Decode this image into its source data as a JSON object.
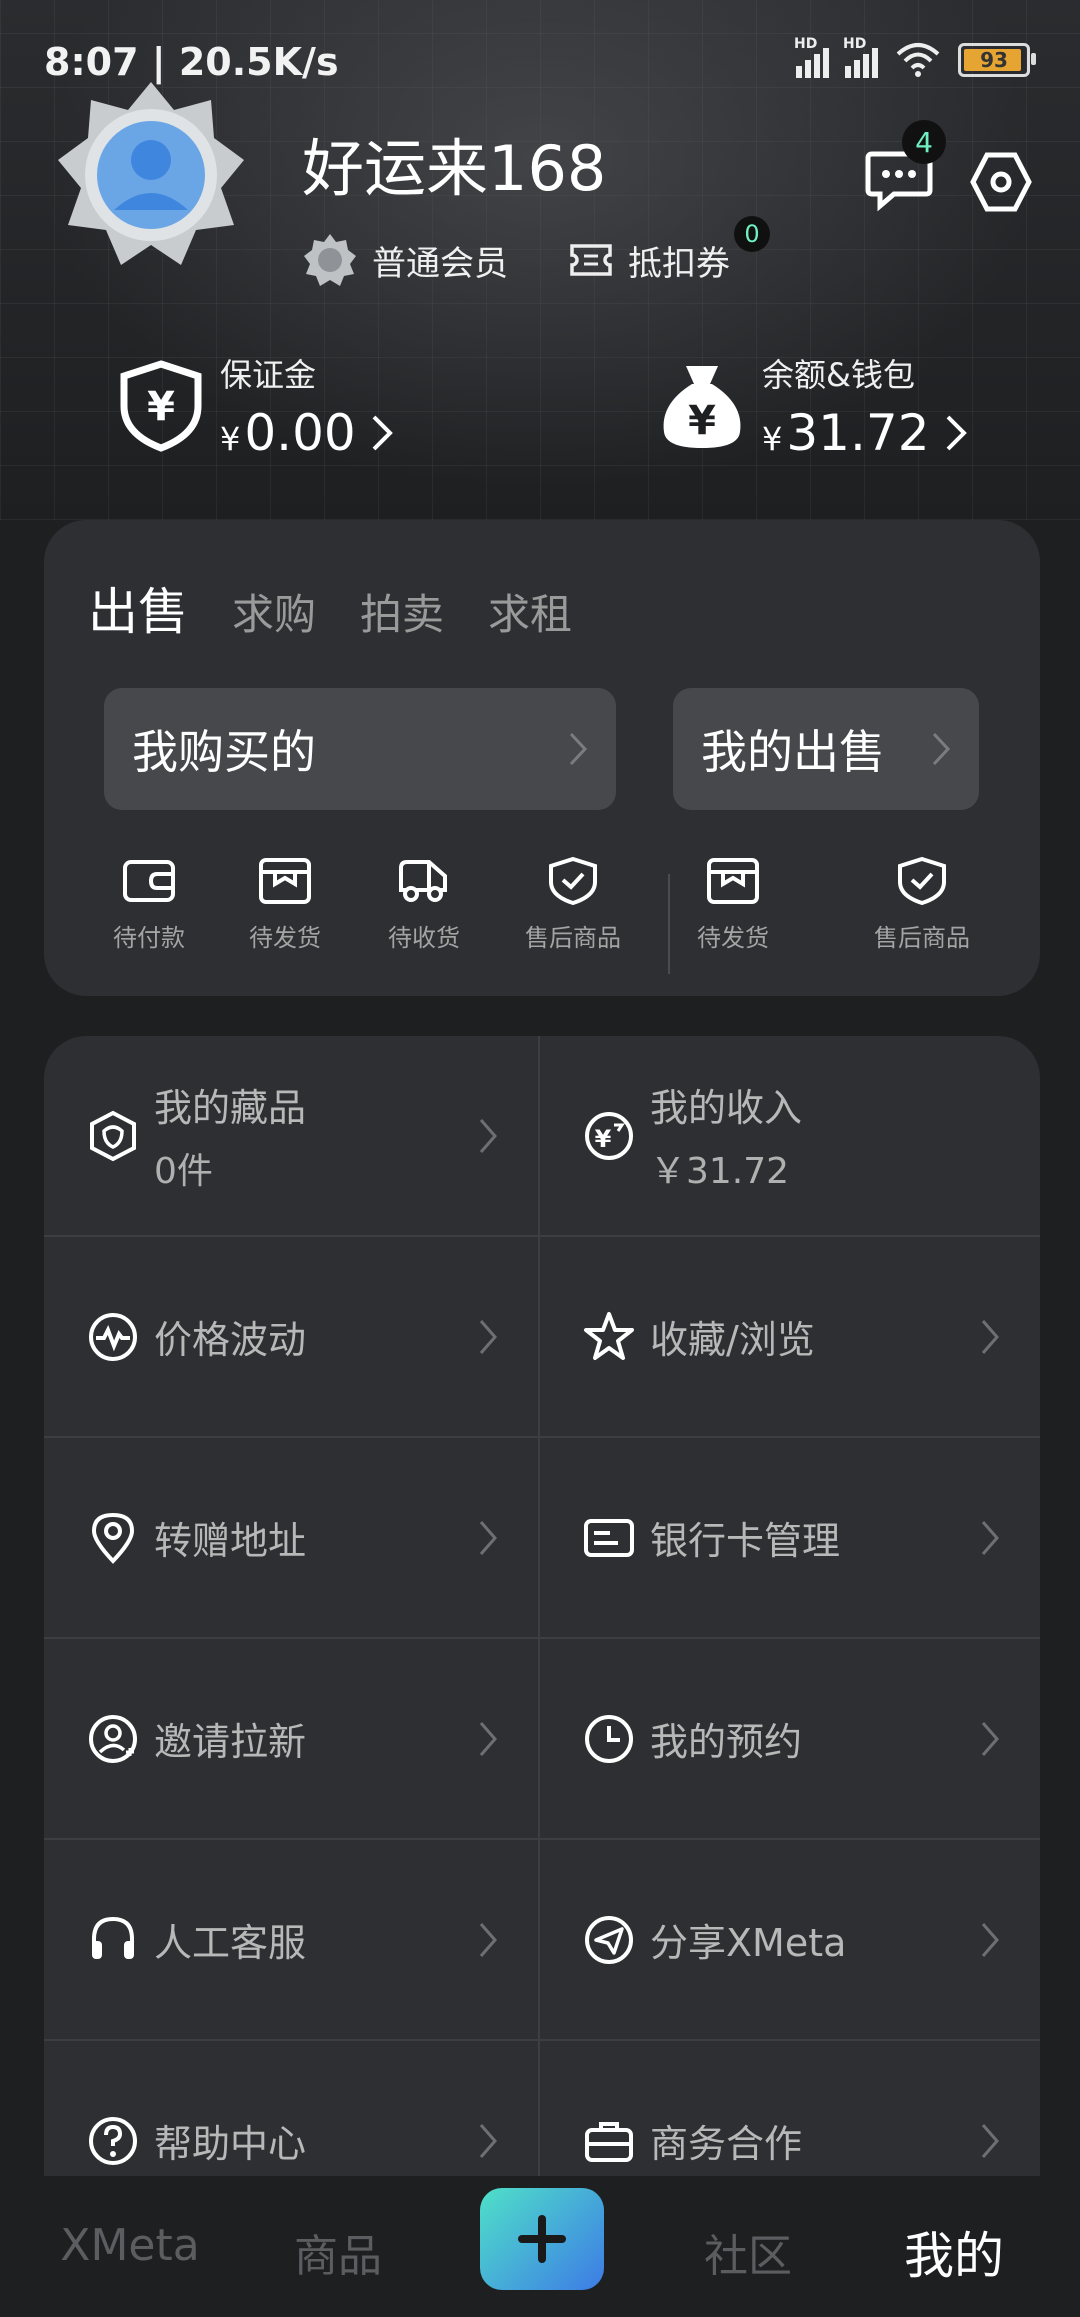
{
  "status_bar": {
    "time_speed": "8:07 | 20.5K/s",
    "battery": "93",
    "network_label": "HD"
  },
  "profile": {
    "username": "好运来168",
    "member_level": "普通会员",
    "coupon_label": "抵扣券",
    "coupon_count": "0",
    "message_count": "4"
  },
  "funds": {
    "deposit": {
      "label": "保证金",
      "currency": "¥",
      "amount": "0.00"
    },
    "wallet": {
      "label": "余额&钱包",
      "currency": "¥",
      "amount": "31.72"
    }
  },
  "trade": {
    "tabs": [
      "出售",
      "求购",
      "拍卖",
      "求租"
    ],
    "my_purchases": "我购买的",
    "my_sales": "我的出售",
    "purchase_status": [
      "待付款",
      "待发货",
      "待收货",
      "售后商品"
    ],
    "sale_status": [
      "待发货",
      "售后商品"
    ]
  },
  "menu": [
    {
      "title": "我的藏品",
      "sub": "0件",
      "icon": "collection-icon"
    },
    {
      "title": "我的收入",
      "sub": "￥31.72",
      "icon": "income-icon"
    },
    {
      "title": "价格波动",
      "icon": "price-wave-icon"
    },
    {
      "title": "收藏/浏览",
      "icon": "star-icon"
    },
    {
      "title": "转赠地址",
      "icon": "location-icon"
    },
    {
      "title": "银行卡管理",
      "icon": "bank-card-icon"
    },
    {
      "title": "邀请拉新",
      "icon": "invite-user-icon"
    },
    {
      "title": "我的预约",
      "icon": "clock-icon"
    },
    {
      "title": "人工客服",
      "icon": "headset-icon"
    },
    {
      "title": "分享XMeta",
      "icon": "share-icon"
    },
    {
      "title": "帮助中心",
      "icon": "help-icon"
    },
    {
      "title": "商务合作",
      "icon": "briefcase-icon"
    }
  ],
  "tabbar": [
    "XMeta",
    "商品",
    "社区",
    "我的"
  ],
  "colors": {
    "accent_teal": "#4fe0c8",
    "accent_blue": "#3d7be6",
    "badge_text": "#6ef0c0"
  }
}
